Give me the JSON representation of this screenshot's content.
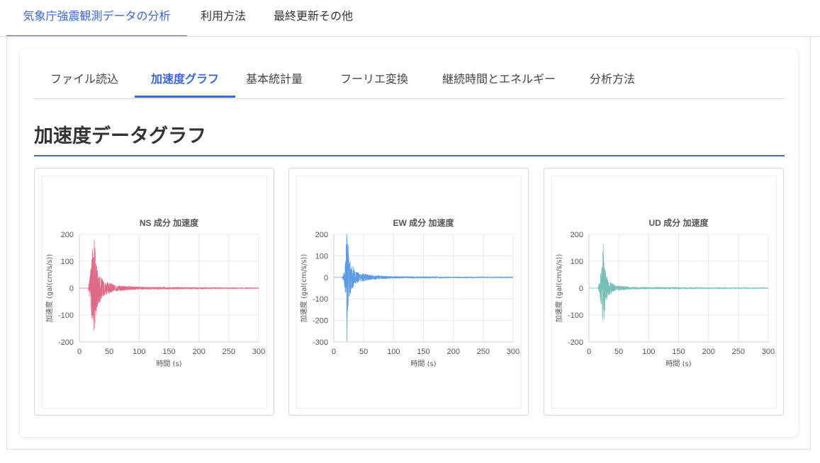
{
  "top_tabs": [
    {
      "label": "気象庁強震観測データの分析",
      "active": true
    },
    {
      "label": "利用方法",
      "active": false
    },
    {
      "label": "最終更新その他",
      "active": false
    }
  ],
  "sub_tabs": [
    {
      "label": "ファイル読込",
      "active": false
    },
    {
      "label": "加速度グラフ",
      "active": true
    },
    {
      "label": "基本統計量",
      "active": false
    },
    {
      "label": "フーリエ変換",
      "active": false
    },
    {
      "label": "継続時間とエネルギー",
      "active": false
    },
    {
      "label": "分析方法",
      "active": false
    }
  ],
  "section_title": "加速度データグラフ",
  "colors": {
    "accent": "#3a66d6",
    "ns": "#e06a85",
    "ew": "#5b9be6",
    "ud": "#76bfb8"
  },
  "chart_data": [
    {
      "type": "line",
      "title": "NS 成分 加速度",
      "xlabel": "時間 (s)",
      "ylabel": "加速度 (gal(cm/s/s))",
      "xlim": [
        0,
        300
      ],
      "ylim": [
        -200,
        200
      ],
      "xticks": [
        0,
        50,
        100,
        150,
        200,
        250,
        300
      ],
      "yticks": [
        200,
        100,
        0,
        -100,
        -200
      ],
      "grid": true,
      "series": [
        {
          "color": "#e06a85",
          "peak_time": 25,
          "envelope": [
            [
              15,
              0
            ],
            [
              18,
              60
            ],
            [
              22,
              150
            ],
            [
              25,
              180
            ],
            [
              28,
              110
            ],
            [
              32,
              60
            ],
            [
              40,
              30
            ],
            [
              60,
              12
            ],
            [
              100,
              5
            ],
            [
              300,
              1
            ]
          ]
        }
      ]
    },
    {
      "type": "line",
      "title": "EW 成分 加速度",
      "xlabel": "時間 (s)",
      "ylabel": "加速度 (gal(cm/s/s))",
      "xlim": [
        0,
        300
      ],
      "ylim": [
        -300,
        200
      ],
      "xticks": [
        0,
        50,
        100,
        150,
        200,
        250,
        300
      ],
      "yticks": [
        200,
        100,
        0,
        -100,
        -200,
        -300
      ],
      "grid": true,
      "series": [
        {
          "color": "#5b9be6",
          "peak_time": 22,
          "envelope": [
            [
              14,
              0
            ],
            [
              18,
              40
            ],
            [
              21,
              180
            ],
            [
              22,
              300
            ],
            [
              25,
              120
            ],
            [
              30,
              60
            ],
            [
              40,
              25
            ],
            [
              60,
              12
            ],
            [
              100,
              5
            ],
            [
              300,
              1
            ]
          ]
        }
      ]
    },
    {
      "type": "line",
      "title": "UD 成分 加速度",
      "xlabel": "時間 (s)",
      "ylabel": "加速度 (gal(cm/s/s))",
      "xlim": [
        0,
        300
      ],
      "ylim": [
        -200,
        200
      ],
      "xticks": [
        0,
        50,
        100,
        150,
        200,
        250,
        300
      ],
      "yticks": [
        200,
        100,
        0,
        -100,
        -200
      ],
      "grid": true,
      "series": [
        {
          "color": "#76bfb8",
          "peak_time": 24,
          "envelope": [
            [
              15,
              0
            ],
            [
              18,
              30
            ],
            [
              22,
              90
            ],
            [
              24,
              165
            ],
            [
              27,
              70
            ],
            [
              32,
              30
            ],
            [
              45,
              10
            ],
            [
              80,
              4
            ],
            [
              300,
              1
            ]
          ]
        }
      ]
    }
  ]
}
